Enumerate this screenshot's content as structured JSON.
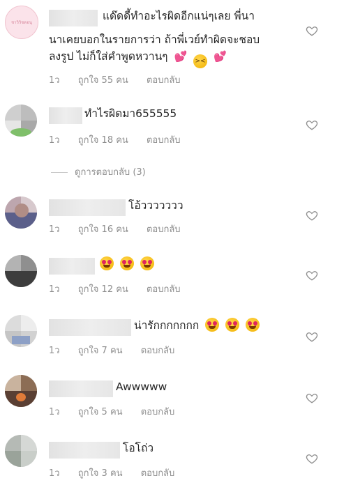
{
  "comments": [
    {
      "text_line1": "แด๊ดดี้ทำอะไรผิดอีกแน่ๆเลย พี่นา",
      "text_line2": "นาเคยบอกในรายการว่า ถ้าพี่เวย์ทำผิดจะชอบ",
      "text_line3": "ลงรูป ไม่ก็ใส่คำพูดหวานๆ",
      "emoji_hearts": "💕",
      "avatar_caption": "ชาวิวิชดอนุ",
      "time": "1ว",
      "likes": "ถูกใจ 55 คน",
      "reply": "ตอบกลับ"
    },
    {
      "text": "ทำไรผิดมา655555",
      "time": "1ว",
      "likes": "ถูกใจ 18 คน",
      "reply": "ตอบกลับ"
    },
    {
      "text": "โอ้ววววววว",
      "time": "1ว",
      "likes": "ถูกใจ 16 คน",
      "reply": "ตอบกลับ"
    },
    {
      "text": "",
      "time": "1ว",
      "likes": "ถูกใจ 12 คน",
      "reply": "ตอบกลับ"
    },
    {
      "text": "น่ารักกกกกกก",
      "time": "1ว",
      "likes": "ถูกใจ 7 คน",
      "reply": "ตอบกลับ"
    },
    {
      "text": "Awwwww",
      "time": "1ว",
      "likes": "ถูกใจ 5 คน",
      "reply": "ตอบกลับ"
    },
    {
      "text": "โอโถ่ว",
      "time": "1ว",
      "likes": "ถูกใจ 3 คน",
      "reply": "ตอบกลับ"
    }
  ],
  "view_replies": "ดูการตอบกลับ (3)",
  "icons": {
    "like": "heart-outline-icon"
  },
  "colors": {
    "text": "#262626",
    "meta": "#8e8e8e",
    "heart_outline": "#8e8e8e"
  }
}
